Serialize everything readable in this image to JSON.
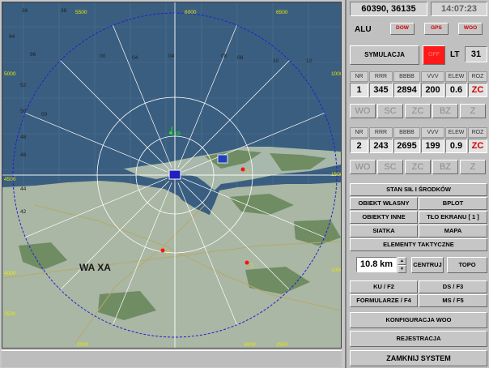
{
  "header": {
    "coordinates": "60390, 36135",
    "time": "14:07:23"
  },
  "alert_row": {
    "label": "ALU",
    "buttons": [
      "DOW",
      "GPS",
      "WOO"
    ]
  },
  "sim_row": {
    "simulation_label": "SYMULACJA",
    "flag_label": "OFF",
    "lt_label": "LT",
    "lt_value": "31"
  },
  "table_headers": [
    "NR",
    "RRR",
    "BBBB",
    "VVV",
    "ELEW",
    "ROZ"
  ],
  "target1": {
    "nr": "1",
    "rrr": "345",
    "bbbb": "2894",
    "vvv": "200",
    "elew": "0.6",
    "roz": "ZC"
  },
  "target2": {
    "nr": "2",
    "rrr": "243",
    "bbbb": "2695",
    "vvv": "199",
    "elew": "0.9",
    "roz": "ZC"
  },
  "mode_buttons": [
    "WO",
    "SC",
    "ZC",
    "BZ",
    "Z"
  ],
  "menu": {
    "stan_sil": "STAN SIŁ I ŚRODKÓW",
    "obiekt_wlasny": "OBIEKT WŁASNY",
    "bplot": "BPLOT",
    "obiekty_inne": "OBIEKTY INNE",
    "tlo_ekranu": "TŁO EKRANU   [ 1 ]",
    "siatka": "SIATKA",
    "mapa": "MAPA",
    "elementy": "ELEMENTY TAKTYCZNE"
  },
  "range": {
    "value": "10.8",
    "unit": "km",
    "up": "▲",
    "down": "▼",
    "centruj": "CENTRUJ",
    "topo": "TOPO"
  },
  "function_keys": {
    "ku": "KU / F2",
    "ds": "DS / F3",
    "form": "FORMULARZE / F4",
    "ms": "MS / F5"
  },
  "bottom": {
    "konfig": "KONFIGURACJA   WOO",
    "rejestracja": "REJESTRACJA",
    "zamknij": "ZAMKNIJ SYSTEM"
  },
  "map": {
    "place_label": "WA  XA",
    "top_grid_labels": [
      "36",
      "38",
      "5500",
      "00",
      "04",
      "08",
      "6000",
      "6500",
      "12"
    ],
    "row_labels": [
      "94",
      "96",
      "5000",
      "00",
      "04",
      "08",
      "10",
      "1000"
    ],
    "side_labels": [
      "52",
      "50",
      "48",
      "46",
      "44",
      "42",
      "4500",
      "1500",
      "1000",
      "4000",
      "3500",
      "2000",
      "2500",
      "3000"
    ],
    "target_labels": [
      "19",
      "1",
      "2",
      "2"
    ],
    "colors": {
      "sea": "#3a5e80",
      "land": "#aab9ab",
      "forest": "#6f8c63",
      "range_circle": "#2020d0",
      "radial": "#ffffff",
      "target": "#ff0000",
      "grid_label": "#e8e800"
    }
  },
  "colors": {
    "panel_bg": "#c0c0c0",
    "alert_red": "#ff2020",
    "roz_red": "#d00000"
  }
}
